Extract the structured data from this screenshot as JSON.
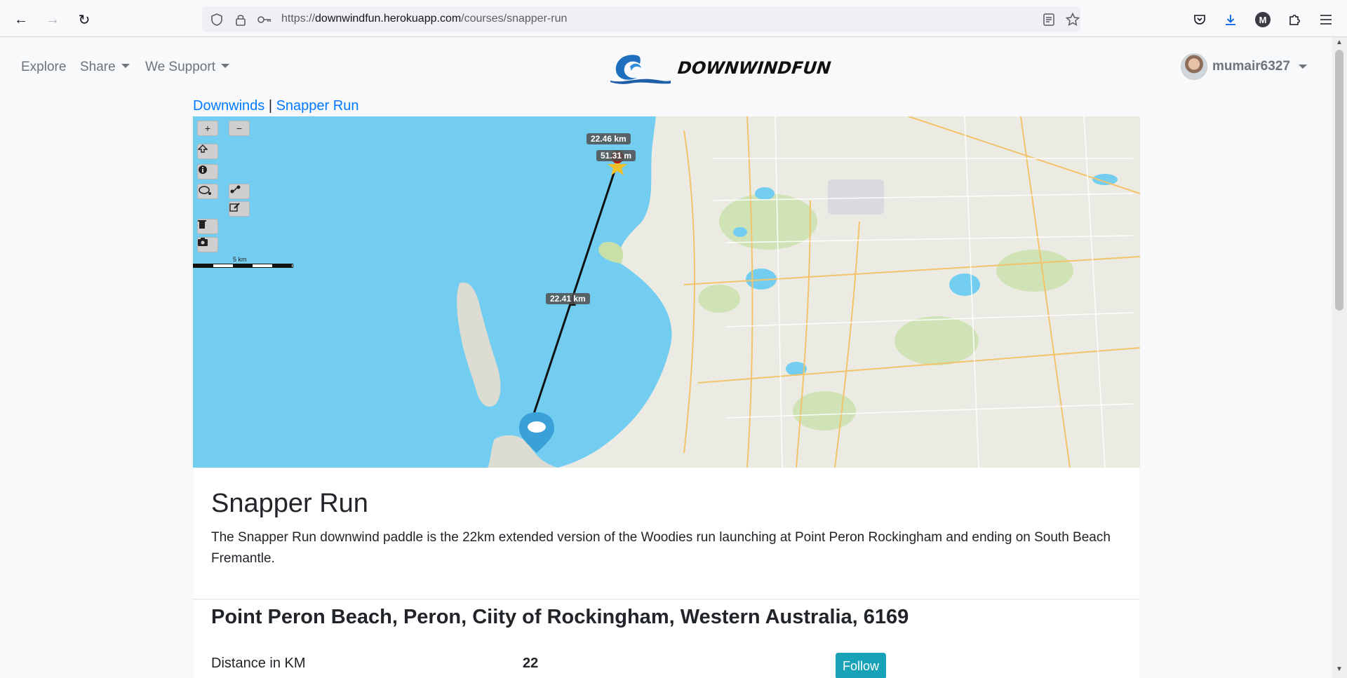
{
  "browser": {
    "url_prefix": "https://",
    "url_host": "downwindfun.herokuapp.com",
    "url_path": "/courses/snapper-run"
  },
  "navbar": {
    "explore": "Explore",
    "share": "Share",
    "we_support": "We Support",
    "logo_text": "DOWNWINDFUN",
    "username": "mumair6327"
  },
  "breadcrumb": {
    "parent": "Downwinds",
    "separator": " | ",
    "current": "Snapper Run"
  },
  "map": {
    "total_distance_label": "22.46 km",
    "elevation_label": "51.31 m",
    "segment_label": "22.41 km",
    "scale_label": "5 km",
    "controls": {
      "zoom_in": "+",
      "zoom_out": "−"
    }
  },
  "course": {
    "title": "Snapper Run",
    "description": "The Snapper Run downwind paddle is the 22km extended version of the Woodies run launching at Point Peron Rockingham and ending on South Beach Fremantle.",
    "location": "Point Peron Beach, Peron, Ciity of Rockingham, Western Australia, 6169",
    "distance_label": "Distance in KM",
    "distance_value": "22",
    "follow_label": "Follow"
  },
  "colors": {
    "link": "#007bff",
    "follow_button": "#17a2b8",
    "water": "#73cdf0",
    "land": "#ecebe3"
  }
}
